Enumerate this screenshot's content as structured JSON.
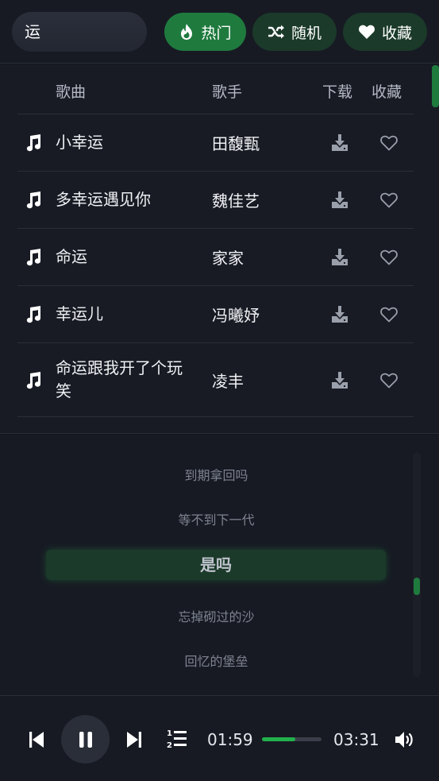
{
  "search": {
    "value": "运"
  },
  "filters": {
    "hot": {
      "label": "热门",
      "icon": "flame-icon"
    },
    "random": {
      "label": "随机",
      "icon": "shuffle-icon"
    },
    "favorites": {
      "label": "收藏",
      "icon": "heart-icon"
    }
  },
  "table": {
    "headers": {
      "song": "歌曲",
      "artist": "歌手",
      "download": "下载",
      "favorite": "收藏"
    },
    "rows": [
      {
        "title": "小幸运",
        "artist": "田馥甄"
      },
      {
        "title": "多幸运遇见你",
        "artist": "魏佳艺"
      },
      {
        "title": "命运",
        "artist": "家家"
      },
      {
        "title": "幸运儿",
        "artist": "冯曦妤"
      },
      {
        "title": "命运跟我开了个玩笑",
        "artist": "凌丰"
      }
    ]
  },
  "lyrics": {
    "lines": [
      "到期拿回吗",
      "等不到下一代",
      "是吗",
      "忘掉砌过的沙",
      "回忆的堡垒"
    ],
    "active_index": 2
  },
  "player": {
    "current_time": "01:59",
    "total_time": "03:31",
    "progress": 0.564,
    "state": "playing"
  },
  "colors": {
    "accent": "#1f7a3e",
    "accent_dim": "#1b3a2a",
    "progress": "#22b04c",
    "background": "#14171f"
  }
}
